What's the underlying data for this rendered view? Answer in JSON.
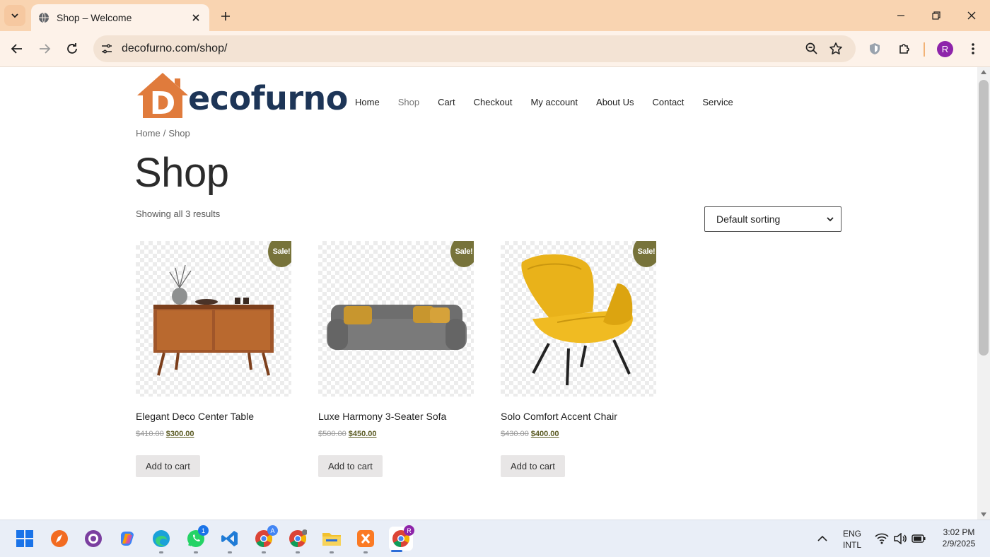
{
  "browser": {
    "tab_title": "Shop – Welcome",
    "url": "decofurno.com/shop/",
    "profile_initial": "R"
  },
  "site": {
    "logo_letter": "D",
    "logo_text": "ecofurno",
    "nav": [
      {
        "label": "Home",
        "active": false
      },
      {
        "label": "Shop",
        "active": true
      },
      {
        "label": "Cart",
        "active": false
      },
      {
        "label": "Checkout",
        "active": false
      },
      {
        "label": "My account",
        "active": false
      },
      {
        "label": "About Us",
        "active": false
      },
      {
        "label": "Contact",
        "active": false
      },
      {
        "label": "Service",
        "active": false
      }
    ],
    "breadcrumb": [
      "Home",
      "Shop"
    ],
    "breadcrumb_sep": "/",
    "page_title": "Shop",
    "result_count": "Showing all 3 results",
    "sort_selected": "Default sorting"
  },
  "products": [
    {
      "name": "Elegant Deco Center Table",
      "old_price": "$410.00",
      "price": "$300.00",
      "badge": "Sale!",
      "button": "Add to cart"
    },
    {
      "name": "Luxe Harmony 3-Seater Sofa",
      "old_price": "$500.00",
      "price": "$450.00",
      "badge": "Sale!",
      "button": "Add to cart"
    },
    {
      "name": "Solo Comfort Accent Chair",
      "old_price": "$430.00",
      "price": "$400.00",
      "badge": "Sale!",
      "button": "Add to cart"
    }
  ],
  "taskbar": {
    "whatsapp_badge": "1",
    "chrome_a_badge": "A",
    "chrome_r_badge": "R",
    "lang_top": "ENG",
    "lang_bottom": "INTL",
    "time": "3:02 PM",
    "date": "2/9/2025"
  },
  "colors": {
    "tabstrip": "#f9d4b1",
    "brand_navy": "#1d3557",
    "brand_orange": "#e07b3c",
    "sale_badge": "#77733a"
  }
}
